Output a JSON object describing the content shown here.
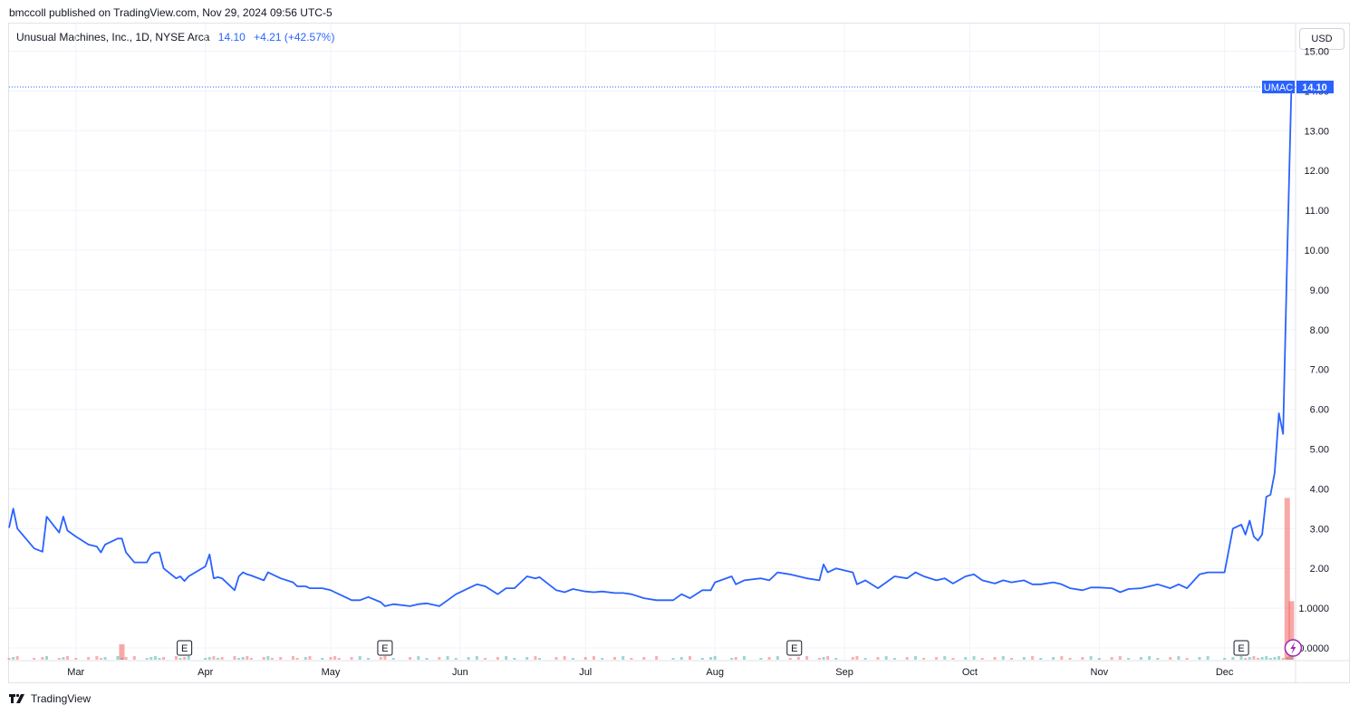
{
  "header": {
    "published": "bmccoll published on TradingView.com, Nov 29, 2024 09:56 UTC-5"
  },
  "legend": {
    "symbol": "Unusual Machines, Inc., 1D, NYSE Arca",
    "price": "14.10",
    "change": "+4.21 (+42.57%)"
  },
  "toolbar": {
    "currency": "USD"
  },
  "footer": {
    "brand": "TradingView"
  },
  "colors": {
    "line": "#2962ff",
    "vol_up": "#26a69a",
    "vol_down": "#ef5350",
    "grid": "#f0f3fa"
  },
  "chart_data": {
    "type": "line",
    "ticker": "UMAC",
    "last_value_label": "14.10",
    "y_ticks": [
      "0.0000",
      "1.0000",
      "2.00",
      "3.00",
      "4.00",
      "5.00",
      "6.00",
      "7.00",
      "8.00",
      "9.00",
      "10.00",
      "11.00",
      "12.00",
      "13.00",
      "14.00",
      "15.00"
    ],
    "x_ticks": [
      "Mar",
      "Apr",
      "May",
      "Jun",
      "Jul",
      "Aug",
      "Sep",
      "Oct",
      "Nov",
      "Dec"
    ],
    "ylim": [
      0,
      15
    ],
    "grid": true,
    "x_start": "2024-02-14",
    "x_end": "2024-12-18",
    "series": [
      {
        "values": [
          [
            "2024-02-14",
            3.02
          ],
          [
            "2024-02-15",
            3.5
          ],
          [
            "2024-02-16",
            3.0
          ],
          [
            "2024-02-20",
            2.5
          ],
          [
            "2024-02-22",
            2.42
          ],
          [
            "2024-02-23",
            3.3
          ],
          [
            "2024-02-26",
            2.9
          ],
          [
            "2024-02-27",
            3.3
          ],
          [
            "2024-02-28",
            2.95
          ],
          [
            "2024-03-01",
            2.8
          ],
          [
            "2024-03-04",
            2.6
          ],
          [
            "2024-03-06",
            2.55
          ],
          [
            "2024-03-07",
            2.4
          ],
          [
            "2024-03-08",
            2.6
          ],
          [
            "2024-03-11",
            2.75
          ],
          [
            "2024-03-12",
            2.75
          ],
          [
            "2024-03-13",
            2.4
          ],
          [
            "2024-03-15",
            2.15
          ],
          [
            "2024-03-18",
            2.15
          ],
          [
            "2024-03-19",
            2.35
          ],
          [
            "2024-03-20",
            2.4
          ],
          [
            "2024-03-21",
            2.4
          ],
          [
            "2024-03-22",
            2.0
          ],
          [
            "2024-03-25",
            1.75
          ],
          [
            "2024-03-26",
            1.8
          ],
          [
            "2024-03-27",
            1.68
          ],
          [
            "2024-03-28",
            1.8
          ],
          [
            "2024-04-01",
            2.05
          ],
          [
            "2024-04-02",
            2.35
          ],
          [
            "2024-04-03",
            1.75
          ],
          [
            "2024-04-04",
            1.78
          ],
          [
            "2024-04-05",
            1.75
          ],
          [
            "2024-04-08",
            1.45
          ],
          [
            "2024-04-09",
            1.8
          ],
          [
            "2024-04-10",
            1.9
          ],
          [
            "2024-04-11",
            1.85
          ],
          [
            "2024-04-12",
            1.82
          ],
          [
            "2024-04-15",
            1.7
          ],
          [
            "2024-04-16",
            1.9
          ],
          [
            "2024-04-17",
            1.85
          ],
          [
            "2024-04-19",
            1.75
          ],
          [
            "2024-04-22",
            1.65
          ],
          [
            "2024-04-23",
            1.55
          ],
          [
            "2024-04-25",
            1.55
          ],
          [
            "2024-04-26",
            1.5
          ],
          [
            "2024-04-29",
            1.5
          ],
          [
            "2024-05-01",
            1.45
          ],
          [
            "2024-05-02",
            1.4
          ],
          [
            "2024-05-03",
            1.35
          ],
          [
            "2024-05-06",
            1.2
          ],
          [
            "2024-05-08",
            1.2
          ],
          [
            "2024-05-10",
            1.28
          ],
          [
            "2024-05-13",
            1.15
          ],
          [
            "2024-05-14",
            1.05
          ],
          [
            "2024-05-16",
            1.1
          ],
          [
            "2024-05-20",
            1.05
          ],
          [
            "2024-05-22",
            1.1
          ],
          [
            "2024-05-24",
            1.12
          ],
          [
            "2024-05-27",
            1.05
          ],
          [
            "2024-05-29",
            1.2
          ],
          [
            "2024-05-31",
            1.35
          ],
          [
            "2024-06-03",
            1.5
          ],
          [
            "2024-06-05",
            1.6
          ],
          [
            "2024-06-07",
            1.55
          ],
          [
            "2024-06-10",
            1.35
          ],
          [
            "2024-06-12",
            1.5
          ],
          [
            "2024-06-14",
            1.5
          ],
          [
            "2024-06-17",
            1.8
          ],
          [
            "2024-06-19",
            1.75
          ],
          [
            "2024-06-20",
            1.78
          ],
          [
            "2024-06-24",
            1.45
          ],
          [
            "2024-06-26",
            1.4
          ],
          [
            "2024-06-28",
            1.48
          ],
          [
            "2024-07-01",
            1.42
          ],
          [
            "2024-07-03",
            1.4
          ],
          [
            "2024-07-05",
            1.42
          ],
          [
            "2024-07-08",
            1.38
          ],
          [
            "2024-07-10",
            1.38
          ],
          [
            "2024-07-12",
            1.35
          ],
          [
            "2024-07-15",
            1.25
          ],
          [
            "2024-07-18",
            1.2
          ],
          [
            "2024-07-22",
            1.2
          ],
          [
            "2024-07-24",
            1.35
          ],
          [
            "2024-07-26",
            1.25
          ],
          [
            "2024-07-29",
            1.45
          ],
          [
            "2024-07-31",
            1.45
          ],
          [
            "2024-08-01",
            1.65
          ],
          [
            "2024-08-05",
            1.8
          ],
          [
            "2024-08-06",
            1.6
          ],
          [
            "2024-08-08",
            1.7
          ],
          [
            "2024-08-12",
            1.75
          ],
          [
            "2024-08-14",
            1.7
          ],
          [
            "2024-08-16",
            1.9
          ],
          [
            "2024-08-19",
            1.85
          ],
          [
            "2024-08-21",
            1.8
          ],
          [
            "2024-08-23",
            1.75
          ],
          [
            "2024-08-26",
            1.7
          ],
          [
            "2024-08-27",
            2.1
          ],
          [
            "2024-08-28",
            1.9
          ],
          [
            "2024-08-30",
            2.0
          ],
          [
            "2024-09-03",
            1.9
          ],
          [
            "2024-09-04",
            1.6
          ],
          [
            "2024-09-06",
            1.7
          ],
          [
            "2024-09-09",
            1.5
          ],
          [
            "2024-09-11",
            1.65
          ],
          [
            "2024-09-13",
            1.8
          ],
          [
            "2024-09-16",
            1.75
          ],
          [
            "2024-09-18",
            1.9
          ],
          [
            "2024-09-20",
            1.8
          ],
          [
            "2024-09-23",
            1.7
          ],
          [
            "2024-09-25",
            1.75
          ],
          [
            "2024-09-27",
            1.62
          ],
          [
            "2024-09-30",
            1.8
          ],
          [
            "2024-10-02",
            1.85
          ],
          [
            "2024-10-04",
            1.7
          ],
          [
            "2024-10-07",
            1.62
          ],
          [
            "2024-10-09",
            1.7
          ],
          [
            "2024-10-11",
            1.65
          ],
          [
            "2024-10-14",
            1.7
          ],
          [
            "2024-10-16",
            1.6
          ],
          [
            "2024-10-18",
            1.6
          ],
          [
            "2024-10-21",
            1.65
          ],
          [
            "2024-10-23",
            1.6
          ],
          [
            "2024-10-25",
            1.5
          ],
          [
            "2024-10-28",
            1.45
          ],
          [
            "2024-10-30",
            1.52
          ],
          [
            "2024-11-01",
            1.52
          ],
          [
            "2024-11-04",
            1.5
          ],
          [
            "2024-11-06",
            1.4
          ],
          [
            "2024-11-08",
            1.48
          ],
          [
            "2024-11-11",
            1.5
          ],
          [
            "2024-11-13",
            1.55
          ],
          [
            "2024-11-15",
            1.6
          ],
          [
            "2024-11-18",
            1.5
          ],
          [
            "2024-11-20",
            1.6
          ],
          [
            "2024-11-22",
            1.5
          ],
          [
            "2024-11-25",
            1.85
          ],
          [
            "2024-11-27",
            1.9
          ],
          [
            "2024-12-01",
            1.9
          ],
          [
            "2024-12-03",
            3.0
          ],
          [
            "2024-12-05",
            3.1
          ],
          [
            "2024-12-06",
            2.85
          ],
          [
            "2024-12-07",
            3.2
          ],
          [
            "2024-12-08",
            2.8
          ],
          [
            "2024-12-09",
            2.7
          ],
          [
            "2024-12-10",
            2.85
          ],
          [
            "2024-12-11",
            3.8
          ],
          [
            "2024-12-12",
            3.85
          ],
          [
            "2024-12-13",
            4.4
          ],
          [
            "2024-12-14",
            5.9
          ],
          [
            "2024-12-15",
            5.38
          ],
          [
            "2024-12-16",
            9.89
          ],
          [
            "2024-12-17",
            14.1
          ]
        ]
      }
    ],
    "volume_spikes": [
      {
        "date": "2024-03-12",
        "rel": 0.09,
        "dir": "down"
      },
      {
        "date": "2024-12-16",
        "rel": 0.94,
        "dir": "down"
      },
      {
        "date": "2024-12-17",
        "rel": 0.34,
        "dir": "down"
      }
    ],
    "earnings_markers": [
      {
        "date": "2024-03-27",
        "label": "E"
      },
      {
        "date": "2024-05-14",
        "label": "E"
      },
      {
        "date": "2024-08-20",
        "label": "E"
      },
      {
        "date": "2024-12-05",
        "label": "E"
      }
    ]
  }
}
